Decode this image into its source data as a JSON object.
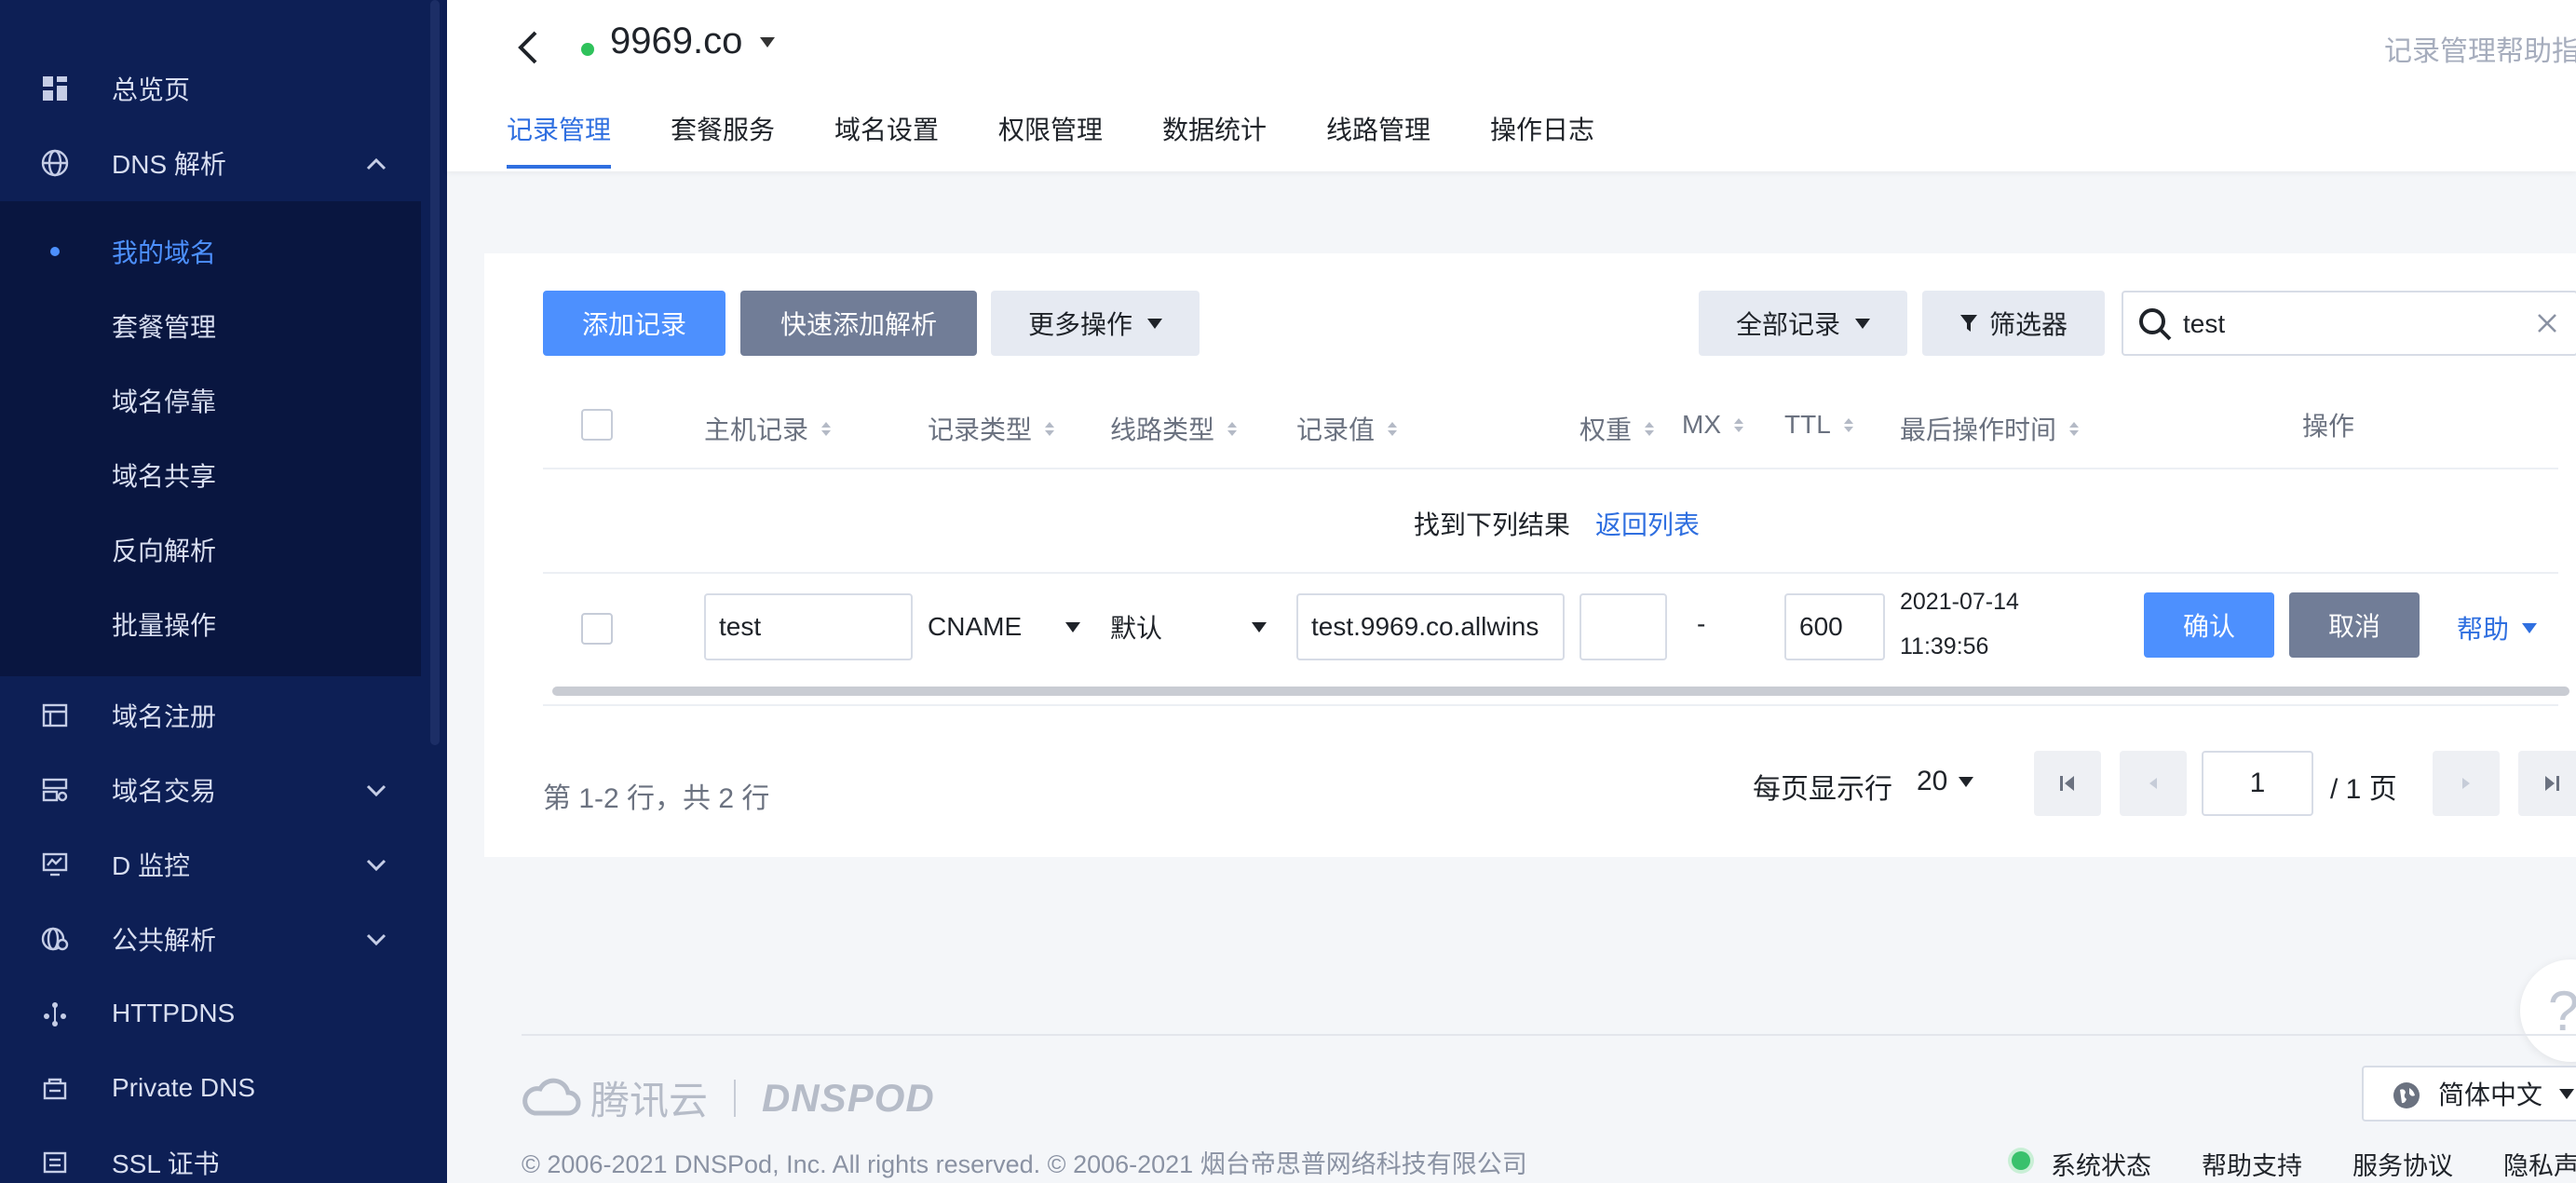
{
  "sidebar": {
    "items": [
      {
        "label": "总览页",
        "icon": "dashboard-icon"
      },
      {
        "label": "DNS 解析",
        "icon": "globe-icon"
      },
      {
        "label": "域名注册",
        "icon": "calendar-icon"
      },
      {
        "label": "域名交易",
        "icon": "trade-icon"
      },
      {
        "label": "D 监控",
        "icon": "monitor-icon"
      },
      {
        "label": "公共解析",
        "icon": "public-dns-icon"
      },
      {
        "label": "HTTPDNS",
        "icon": "httpdns-icon"
      },
      {
        "label": "Private DNS",
        "icon": "private-dns-icon"
      },
      {
        "label": "SSL 证书",
        "icon": "certificate-icon"
      }
    ],
    "submenu": [
      {
        "label": "我的域名",
        "active": true
      },
      {
        "label": "套餐管理"
      },
      {
        "label": "域名停靠"
      },
      {
        "label": "域名共享"
      },
      {
        "label": "反向解析"
      },
      {
        "label": "批量操作"
      }
    ]
  },
  "header": {
    "domain": "9969.co",
    "help_link": "记录管理帮助指",
    "tabs": [
      "记录管理",
      "套餐服务",
      "域名设置",
      "权限管理",
      "数据统计",
      "线路管理",
      "操作日志"
    ]
  },
  "toolbar": {
    "add_record": "添加记录",
    "quick_add": "快速添加解析",
    "more_ops": "更多操作",
    "all_records": "全部记录",
    "filter": "筛选器",
    "search_value": "test"
  },
  "table": {
    "headers": {
      "host": "主机记录",
      "type": "记录类型",
      "line": "线路类型",
      "value": "记录值",
      "weight": "权重",
      "mx": "MX",
      "ttl": "TTL",
      "last_op": "最后操作时间",
      "ops": "操作"
    },
    "found_text": "找到下列结果",
    "back_to_list": "返回列表",
    "row": {
      "host": "test",
      "type": "CNAME",
      "line": "默认",
      "value": "test.9969.co.allwins",
      "weight": "",
      "mx": "-",
      "ttl": "600",
      "date": "2021-07-14",
      "time": "11:39:56",
      "confirm": "确认",
      "cancel": "取消",
      "help": "帮助"
    }
  },
  "pagination": {
    "info": "第 1-2 行，共 2 行",
    "per_page_label": "每页显示行",
    "per_page_value": "20",
    "current_page": "1",
    "total_pages": "/ 1 页"
  },
  "footer": {
    "brand_cloud": "腾讯云",
    "brand_dnspod": "DNSPOD",
    "copyright": "© 2006-2021 DNSPod, Inc. All rights reserved. © 2006-2021 烟台帝思普网络科技有限公司",
    "language": "简体中文",
    "links": [
      "系统状态",
      "帮助支持",
      "服务协议",
      "隐私声"
    ],
    "float_help": "?"
  }
}
